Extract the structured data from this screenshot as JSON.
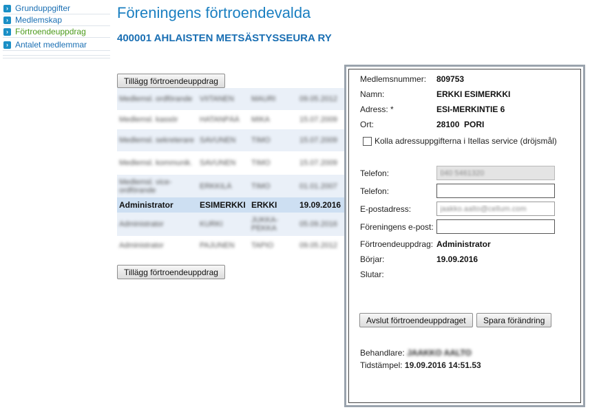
{
  "sidebar": {
    "items": [
      {
        "label": "Grunduppgifter"
      },
      {
        "label": "Medlemskap"
      },
      {
        "label": "Förtroendeuppdrag"
      },
      {
        "label": "Antalet medlemmar"
      }
    ]
  },
  "main": {
    "title": "Föreningens förtroendevalda",
    "org": "400001 AHLAISTEN METSÄSTYSSEURA RY",
    "add_label": "Tillägg förtroendeuppdrag",
    "rows": [
      {
        "role": "Medlemsl. ordförande",
        "last": "VIITANEN",
        "first": "MAURI",
        "date": "09.05.2012"
      },
      {
        "role": "Medlemsl. kassör",
        "last": "HATANPÄÄ",
        "first": "MIKA",
        "date": "15.07.2009"
      },
      {
        "role": "Medlemsl. sekreterare",
        "last": "SAVUNEN",
        "first": "TIMO",
        "date": "15.07.2009"
      },
      {
        "role": "Medlemsl. kommunik.",
        "last": "SAVUNEN",
        "first": "TIMO",
        "date": "15.07.2009"
      },
      {
        "role": "Medlemsl. vice-ordförande",
        "last": "ERKKILÄ",
        "first": "TIMO",
        "date": "01.01.2007"
      },
      {
        "role": "Administrator",
        "last": "ESIMERKKI",
        "first": "ERKKI",
        "date": "19.09.2016"
      },
      {
        "role": "Administrator",
        "last": "KURKI",
        "first": "JUKKA-PEKKA",
        "date": "05.09.2016"
      },
      {
        "role": "Administrator",
        "last": "PAJUNEN",
        "first": "TAPIO",
        "date": "09.05.2012"
      }
    ]
  },
  "detail": {
    "member_no_label": "Medlemsnummer:",
    "member_no": "809753",
    "name_label": "Namn:",
    "name": "ERKKI ESIMERKKI",
    "address_label": "Adress: *",
    "address": "ESI-MERKINTIE 6",
    "city_label": "Ort:",
    "city": "28100  PORI",
    "check_label": "Kolla adressuppgifterna i Itellas service (dröjsmål)",
    "phone1_label": "Telefon:",
    "phone1": "040 5461320",
    "phone2_label": "Telefon:",
    "phone2": "",
    "email_label": "E-postadress:",
    "email": "jaakko.aalto@cellum.com",
    "org_email_label": "Föreningens e-post:",
    "org_email": "",
    "role_label": "Förtroendeuppdrag:",
    "role": "Administrator",
    "start_label": "Börjar:",
    "start": "19.09.2016",
    "end_label": "Slutar:",
    "end": "",
    "end_btn": "Avslut förtroendeuppdraget",
    "save_btn": "Spara förändring",
    "handler_label": "Behandlare:",
    "handler": "JAAKKO AALTO",
    "timestamp_label": "Tidstämpel:",
    "timestamp": "19.09.2016 14:51.53"
  }
}
